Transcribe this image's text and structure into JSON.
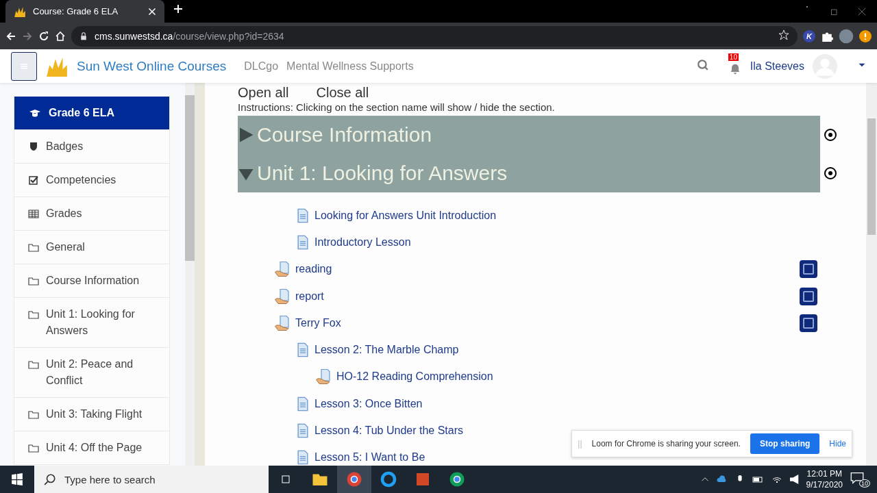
{
  "browser": {
    "tab_title": "Course: Grade 6 ELA",
    "url_host": "cms.sunwestsd.ca",
    "url_path": "/course/view.php?id=2634",
    "extension_letter": "K"
  },
  "navbar": {
    "site_name": "Sun West Online Courses",
    "links": [
      "DLCgo",
      "Mental Wellness Supports"
    ],
    "notification_count": "10",
    "user_name": "Ila Steeves"
  },
  "sidebar": {
    "items": [
      {
        "label": "Grade 6 ELA",
        "kind": "course",
        "selected": true
      },
      {
        "label": "Badges",
        "kind": "badges",
        "selected": false
      },
      {
        "label": "Competencies",
        "kind": "competencies",
        "selected": false
      },
      {
        "label": "Grades",
        "kind": "grades",
        "selected": false
      },
      {
        "label": "General",
        "kind": "section",
        "selected": false
      },
      {
        "label": "Course Information",
        "kind": "section",
        "selected": false
      },
      {
        "label": "Unit 1: Looking for Answers",
        "kind": "section",
        "selected": false
      },
      {
        "label": "Unit 2: Peace and Conflict",
        "kind": "section",
        "selected": false
      },
      {
        "label": "Unit 3: Taking Flight",
        "kind": "section",
        "selected": false
      },
      {
        "label": "Unit 4: Off the Page",
        "kind": "section",
        "selected": false
      }
    ]
  },
  "toggles": [
    "Open all",
    "Close all"
  ],
  "instructions": "Instructions: Clicking on the section name will show / hide the section.",
  "sections": [
    {
      "title": "Course Information",
      "expanded": false
    },
    {
      "title": "Unit 1: Looking for Answers",
      "expanded": true
    }
  ],
  "activities": [
    {
      "kind": "page",
      "label": "Looking for Answers Unit Introduction"
    },
    {
      "kind": "page",
      "label": "Introductory Lesson"
    },
    {
      "kind": "file",
      "label": "reading",
      "checked": false
    },
    {
      "kind": "file",
      "label": "report",
      "checked": false
    },
    {
      "kind": "file",
      "label": "Terry Fox",
      "checked": false
    },
    {
      "kind": "page",
      "label": "Lesson 2: The Marble Champ",
      "children": [
        {
          "kind": "file",
          "label": "HO-12 Reading Comprehension"
        }
      ]
    },
    {
      "kind": "page",
      "label": "Lesson 3: Once Bitten"
    },
    {
      "kind": "page",
      "label": "Lesson 4: Tub Under the Stars"
    },
    {
      "kind": "page",
      "label": "Lesson 5: I Want to Be"
    }
  ],
  "share_bar": {
    "handle": "||",
    "message": "Loom for Chrome is sharing your screen.",
    "stop": "Stop sharing",
    "hide": "Hide"
  },
  "taskbar": {
    "search_placeholder": "Type here to search",
    "time": "12:01 PM",
    "date": "9/17/2020",
    "notification_count": "10"
  }
}
